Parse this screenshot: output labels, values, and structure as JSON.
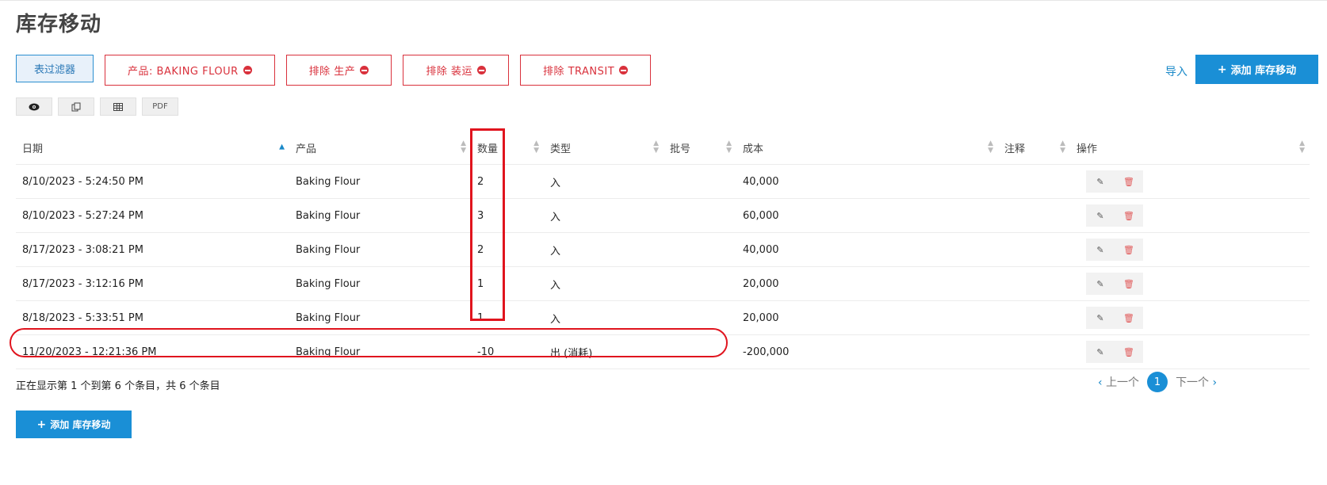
{
  "page": {
    "title": "库存移动"
  },
  "filters": {
    "toggle_label": "表过滤器",
    "chips": [
      "产品: BAKING FLOUR",
      "排除 生产",
      "排除 装运",
      "排除 TRANSIT"
    ]
  },
  "header_actions": {
    "import_label": "导入",
    "add_label": "添加 库存移动"
  },
  "tools": {
    "view_icon": "eye-icon",
    "copy_icon": "copy-icon",
    "table_icon": "table-icon",
    "pdf_label": "PDF"
  },
  "table": {
    "columns": [
      "日期",
      "产品",
      "数量",
      "类型",
      "批号",
      "成本",
      "注释",
      "操作"
    ],
    "rows": [
      {
        "date": "8/10/2023 - 5:24:50 PM",
        "product": "Baking Flour",
        "qty": "2",
        "type": "入",
        "lot": "",
        "cost": "40,000",
        "note": ""
      },
      {
        "date": "8/10/2023 - 5:27:24 PM",
        "product": "Baking Flour",
        "qty": "3",
        "type": "入",
        "lot": "",
        "cost": "60,000",
        "note": ""
      },
      {
        "date": "8/17/2023 - 3:08:21 PM",
        "product": "Baking Flour",
        "qty": "2",
        "type": "入",
        "lot": "",
        "cost": "40,000",
        "note": ""
      },
      {
        "date": "8/17/2023 - 3:12:16 PM",
        "product": "Baking Flour",
        "qty": "1",
        "type": "入",
        "lot": "",
        "cost": "20,000",
        "note": ""
      },
      {
        "date": "8/18/2023 - 5:33:51 PM",
        "product": "Baking Flour",
        "qty": "1",
        "type": "入",
        "lot": "",
        "cost": "20,000",
        "note": ""
      },
      {
        "date": "11/20/2023 - 12:21:36 PM",
        "product": "Baking Flour",
        "qty": "-10",
        "type": "出 (消耗)",
        "lot": "",
        "cost": "-200,000",
        "note": ""
      }
    ]
  },
  "footer": {
    "info": "正在显示第 1 个到第 6 个条目，共 6 个条目",
    "prev_label": "上一个",
    "page": "1",
    "next_label": "下一个",
    "add_label": "添加 库存移动"
  },
  "colors": {
    "accent": "#1a8fd6",
    "danger": "#d9313c",
    "highlight": "#e0141e"
  }
}
